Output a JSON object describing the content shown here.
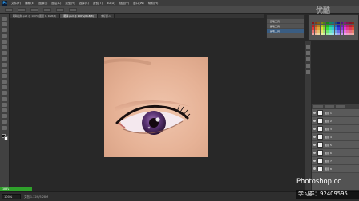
{
  "app": {
    "logo": "Ps"
  },
  "menu": [
    "文件(F)",
    "编辑(E)",
    "图像(I)",
    "图层(L)",
    "类型(Y)",
    "选择(S)",
    "滤镜(T)",
    "3D(D)",
    "视图(V)",
    "窗口(W)",
    "帮助(H)"
  ],
  "tabs": [
    {
      "label": "眼睛绘制.psd @ 100%(图层 1, RGB/8)",
      "active": false
    },
    {
      "label": "眼睛.psd @ 100%(RGB/8)",
      "active": true
    },
    {
      "label": "未标题-1",
      "active": false
    }
  ],
  "history": {
    "items": [
      "画笔工具",
      "画笔工具",
      "画笔工具"
    ],
    "active_index": 2
  },
  "watermark": "优酷",
  "layers": [
    "图层 1",
    "图层 2",
    "图层 3",
    "图层 4",
    "图层 5",
    "图层 6",
    "图层 7",
    "图层 8"
  ],
  "status": {
    "zoom": "100%",
    "doc_info": "文档:1.32M/5.28M"
  },
  "green_tag": "100%",
  "brand": {
    "title": "Photoshop cc",
    "qq": "学习群：92409595"
  },
  "colors": {
    "accent": "#2fa12b",
    "canvas_bg": "#282828",
    "skin": "#e6b296",
    "iris": "#4e2d64"
  }
}
